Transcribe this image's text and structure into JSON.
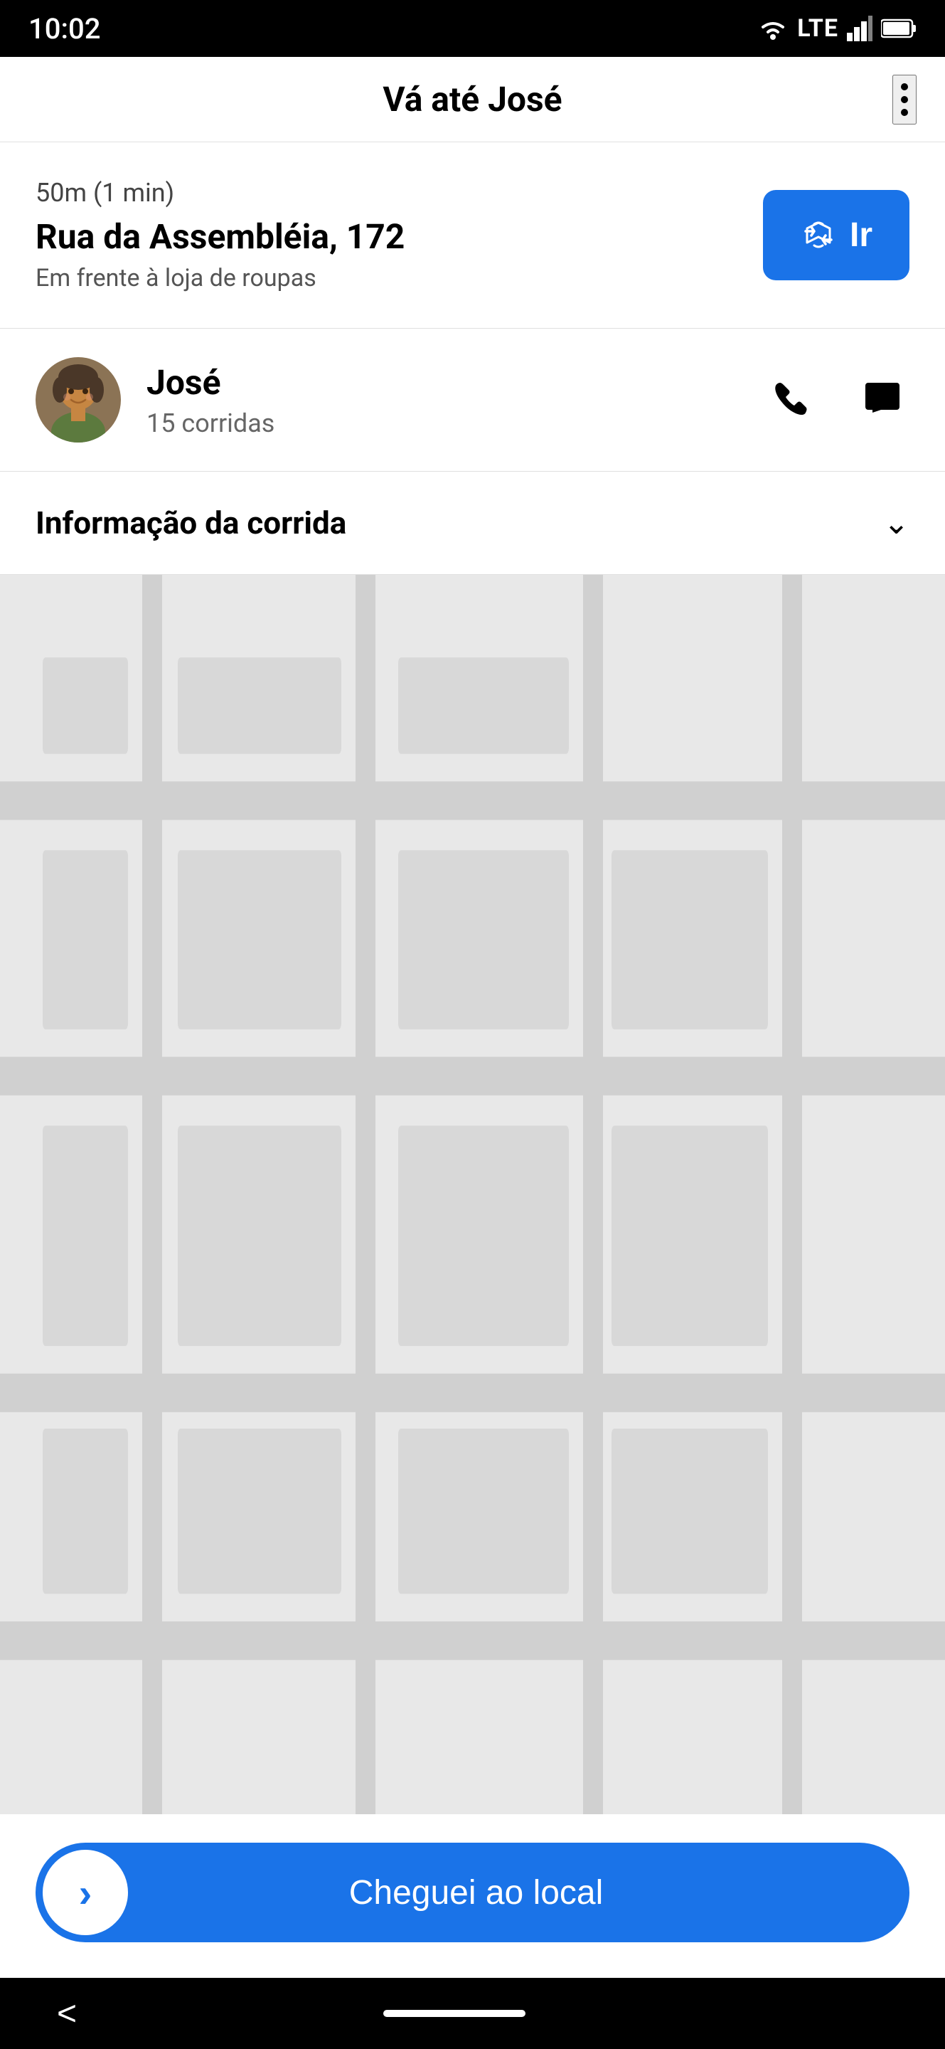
{
  "statusBar": {
    "time": "10:02",
    "icons": {
      "wifi": "▲",
      "lte": "LTE",
      "signal": "▲",
      "battery": "▮"
    }
  },
  "header": {
    "title": "Vá até José",
    "menuLabel": "menu"
  },
  "destination": {
    "meta": "50m (1 min)",
    "address": "Rua da Assembléia, 172",
    "hint": "Em frente à loja de roupas",
    "navigateLabel": "Ir"
  },
  "passenger": {
    "name": "José",
    "rides": "15 corridas",
    "phoneLabel": "ligar",
    "chatLabel": "mensagem"
  },
  "rideInfo": {
    "title": "Informação da corrida",
    "chevron": "chevron-down"
  },
  "map": {
    "placeholder": "map"
  },
  "bottomBar": {
    "arrivedLabel": "Cheguei ao local",
    "arrowLabel": ">"
  },
  "navBar": {
    "backLabel": "<"
  }
}
